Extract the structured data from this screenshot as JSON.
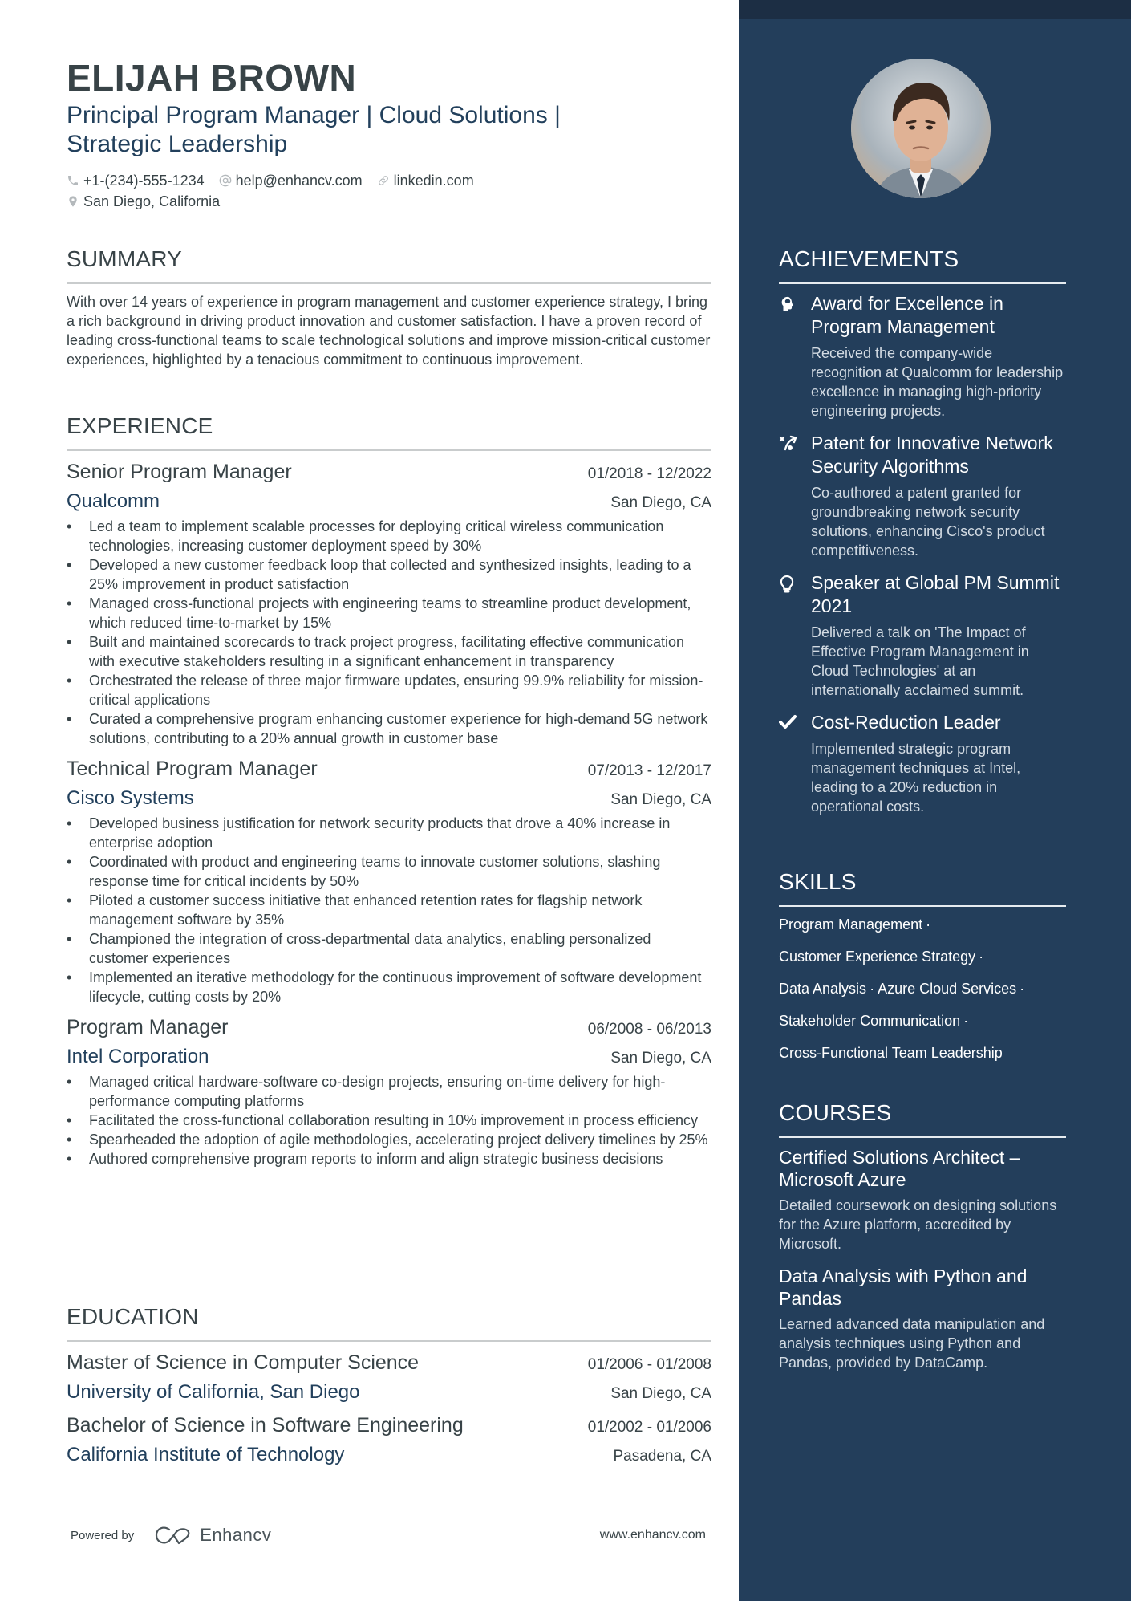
{
  "header": {
    "name": "ELIJAH BROWN",
    "title": "Principal Program Manager | Cloud Solutions | Strategic Leadership",
    "contacts": {
      "phone": "+1-(234)-555-1234",
      "email": "help@enhancv.com",
      "link": "linkedin.com",
      "location": "San Diego, California"
    }
  },
  "summary": {
    "heading": "SUMMARY",
    "text": "With over 14 years of experience in program management and customer experience strategy, I bring a rich background in driving product innovation and customer satisfaction. I have a proven record of leading cross-functional teams to scale technological solutions and improve mission-critical customer experiences, highlighted by a tenacious commitment to continuous improvement."
  },
  "experience": {
    "heading": "EXPERIENCE",
    "jobs": [
      {
        "role": "Senior Program Manager",
        "dates": "01/2018 - 12/2022",
        "company": "Qualcomm",
        "location": "San Diego, CA",
        "bullets": [
          "Led a team to implement scalable processes for deploying critical wireless communication technologies, increasing customer deployment speed by 30%",
          "Developed a new customer feedback loop that collected and synthesized insights, leading to a 25% improvement in product satisfaction",
          "Managed cross-functional projects with engineering teams to streamline product development, which reduced time-to-market by 15%",
          "Built and maintained scorecards to track project progress, facilitating effective communication with executive stakeholders resulting in a significant enhancement in transparency",
          "Orchestrated the release of three major firmware updates, ensuring 99.9% reliability for mission-critical applications",
          "Curated a comprehensive program enhancing customer experience for high-demand 5G network solutions, contributing to a 20% annual growth in customer base"
        ]
      },
      {
        "role": "Technical Program Manager",
        "dates": "07/2013 - 12/2017",
        "company": "Cisco Systems",
        "location": "San Diego, CA",
        "bullets": [
          "Developed business justification for network security products that drove a 40% increase in enterprise adoption",
          "Coordinated with product and engineering teams to innovate customer solutions, slashing response time for critical incidents by 50%",
          "Piloted a customer success initiative that enhanced retention rates for flagship network management software by 35%",
          "Championed the integration of cross-departmental data analytics, enabling personalized customer experiences",
          "Implemented an iterative methodology for the continuous improvement of software development lifecycle, cutting costs by 20%"
        ]
      },
      {
        "role": "Program Manager",
        "dates": "06/2008 - 06/2013",
        "company": "Intel Corporation",
        "location": "San Diego, CA",
        "bullets": [
          "Managed critical hardware-software co-design projects, ensuring on-time delivery for high-performance computing platforms",
          "Facilitated the cross-functional collaboration resulting in 10% improvement in process efficiency",
          "Spearheaded the adoption of agile methodologies, accelerating project delivery timelines by 25%",
          "Authored comprehensive program reports to inform and align strategic business decisions"
        ]
      }
    ]
  },
  "education": {
    "heading": "EDUCATION",
    "items": [
      {
        "degree": "Master of Science in Computer Science",
        "dates": "01/2006 - 01/2008",
        "school": "University of California, San Diego",
        "location": "San Diego, CA"
      },
      {
        "degree": "Bachelor of Science in Software Engineering",
        "dates": "01/2002 - 01/2006",
        "school": "California Institute of Technology",
        "location": "Pasadena, CA"
      }
    ]
  },
  "footer": {
    "powered_by": "Powered by",
    "brand": "Enhancv",
    "url": "www.enhancv.com"
  },
  "sidebar": {
    "achievements": {
      "heading": "ACHIEVEMENTS",
      "items": [
        {
          "icon": "head-brain-icon",
          "title": "Award for Excellence in Program Management",
          "description": "Received the company-wide recognition at Qualcomm for leadership excellence in managing high-priority engineering projects."
        },
        {
          "icon": "strategy-icon",
          "title": "Patent for Innovative Network Security Algorithms",
          "description": "Co-authored a patent granted for groundbreaking network security solutions, enhancing Cisco's product competitiveness."
        },
        {
          "icon": "lightbulb-icon",
          "title": "Speaker at Global PM Summit 2021",
          "description": "Delivered a talk on 'The Impact of Effective Program Management in Cloud Technologies' at an internationally acclaimed summit."
        },
        {
          "icon": "checkmark-icon",
          "title": "Cost-Reduction Leader",
          "description": "Implemented strategic program management techniques at Intel, leading to a 20% reduction in operational costs."
        }
      ]
    },
    "skills": {
      "heading": "SKILLS",
      "lines": [
        [
          "Program Management"
        ],
        [
          "Customer Experience Strategy"
        ],
        [
          "Data Analysis",
          "Azure Cloud Services"
        ],
        [
          "Stakeholder Communication"
        ],
        [
          "Cross-Functional Team Leadership"
        ]
      ],
      "separator": "·"
    },
    "courses": {
      "heading": "COURSES",
      "items": [
        {
          "title": "Certified Solutions Architect – Microsoft Azure",
          "description": "Detailed coursework on designing solutions for the Azure platform, accredited by Microsoft."
        },
        {
          "title": "Data Analysis with Python and Pandas",
          "description": "Learned advanced data manipulation and analysis techniques using Python and Pandas, provided by DataCamp."
        }
      ]
    }
  }
}
